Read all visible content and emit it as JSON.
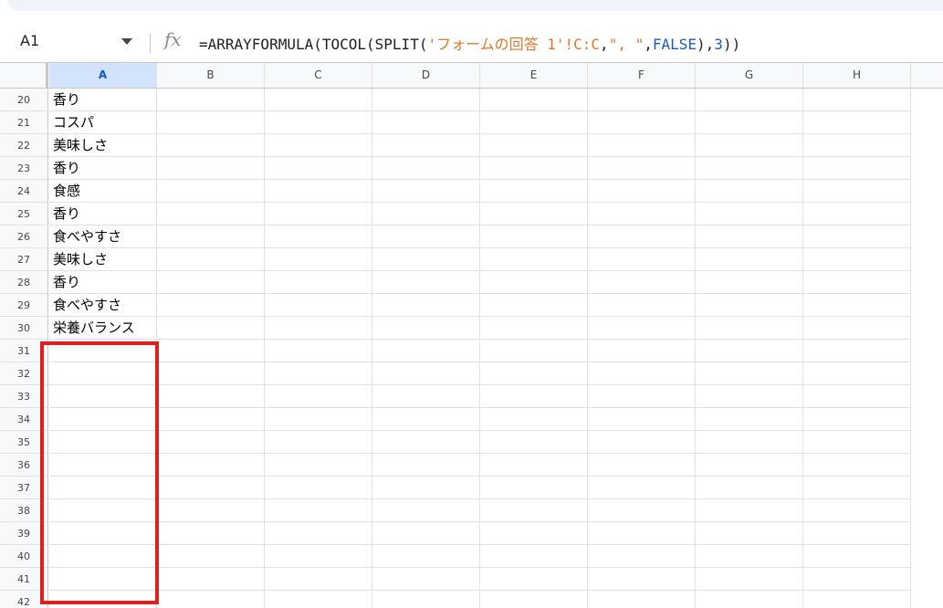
{
  "name_box": "A1",
  "formula_tokens": [
    {
      "text": "=ARRAYFORMULA(TOCOL(SPLIT(",
      "kind": "default"
    },
    {
      "text": "'フォームの回答 1'!C:C",
      "kind": "string"
    },
    {
      "text": ",",
      "kind": "default"
    },
    {
      "text": "\", \"",
      "kind": "string"
    },
    {
      "text": ",",
      "kind": "default"
    },
    {
      "text": "FALSE",
      "kind": "bool"
    },
    {
      "text": "),",
      "kind": "default"
    },
    {
      "text": "3",
      "kind": "bool"
    },
    {
      "text": "))",
      "kind": "default"
    }
  ],
  "columns": [
    "A",
    "B",
    "C",
    "D",
    "E",
    "F",
    "G",
    "H"
  ],
  "selected_column": "A",
  "rows": [
    {
      "num": "20",
      "a": "香り"
    },
    {
      "num": "21",
      "a": "コスパ"
    },
    {
      "num": "22",
      "a": "美味しさ"
    },
    {
      "num": "23",
      "a": "香り"
    },
    {
      "num": "24",
      "a": "食感"
    },
    {
      "num": "25",
      "a": "香り"
    },
    {
      "num": "26",
      "a": "食べやすさ"
    },
    {
      "num": "27",
      "a": "美味しさ"
    },
    {
      "num": "28",
      "a": "香り"
    },
    {
      "num": "29",
      "a": "食べやすさ"
    },
    {
      "num": "30",
      "a": "栄養バランス"
    },
    {
      "num": "31",
      "a": ""
    },
    {
      "num": "32",
      "a": ""
    },
    {
      "num": "33",
      "a": ""
    },
    {
      "num": "34",
      "a": ""
    },
    {
      "num": "35",
      "a": ""
    },
    {
      "num": "36",
      "a": ""
    },
    {
      "num": "37",
      "a": ""
    },
    {
      "num": "38",
      "a": ""
    },
    {
      "num": "39",
      "a": ""
    },
    {
      "num": "40",
      "a": ""
    },
    {
      "num": "41",
      "a": ""
    },
    {
      "num": "42",
      "a": ""
    }
  ],
  "icons": {
    "fx": "fx-icon",
    "dropdown": "chevron-down-icon"
  },
  "colors": {
    "highlight": "#e01e1e",
    "selected_header": "#d3e3fd",
    "string_token": "#e0782b",
    "keyword_token": "#1c5bbd"
  }
}
